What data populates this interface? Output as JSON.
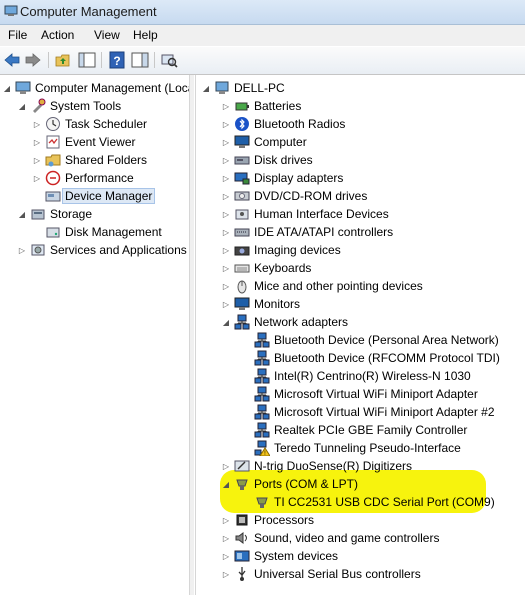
{
  "window": {
    "title": "Computer Management"
  },
  "menu": [
    "File",
    "Action",
    "View",
    "Help"
  ],
  "left_tree": [
    {
      "label": "Computer Management (Local",
      "level": 0,
      "arrow": "open",
      "icon": "computer-mgmt-icon"
    },
    {
      "label": "System Tools",
      "level": 1,
      "arrow": "open",
      "icon": "tools-icon"
    },
    {
      "label": "Task Scheduler",
      "level": 2,
      "arrow": "closed",
      "icon": "clock-icon"
    },
    {
      "label": "Event Viewer",
      "level": 2,
      "arrow": "closed",
      "icon": "event-viewer-icon"
    },
    {
      "label": "Shared Folders",
      "level": 2,
      "arrow": "closed",
      "icon": "shared-folder-icon"
    },
    {
      "label": "Performance",
      "level": 2,
      "arrow": "closed",
      "icon": "performance-icon"
    },
    {
      "label": "Device Manager",
      "level": 2,
      "arrow": "none",
      "icon": "device-manager-icon",
      "selected": true
    },
    {
      "label": "Storage",
      "level": 1,
      "arrow": "open",
      "icon": "storage-icon"
    },
    {
      "label": "Disk Management",
      "level": 2,
      "arrow": "none",
      "icon": "disk-management-icon"
    },
    {
      "label": "Services and Applications",
      "level": 1,
      "arrow": "closed",
      "icon": "services-icon"
    }
  ],
  "device_tree": [
    {
      "label": "DELL-PC",
      "level": 0,
      "arrow": "open",
      "icon": "computer-icon"
    },
    {
      "label": "Batteries",
      "level": 1,
      "arrow": "closed",
      "icon": "battery-icon"
    },
    {
      "label": "Bluetooth Radios",
      "level": 1,
      "arrow": "closed",
      "icon": "bluetooth-icon"
    },
    {
      "label": "Computer",
      "level": 1,
      "arrow": "closed",
      "icon": "monitor-icon"
    },
    {
      "label": "Disk drives",
      "level": 1,
      "arrow": "closed",
      "icon": "disk-drive-icon"
    },
    {
      "label": "Display adapters",
      "level": 1,
      "arrow": "closed",
      "icon": "display-adapter-icon"
    },
    {
      "label": "DVD/CD-ROM drives",
      "level": 1,
      "arrow": "closed",
      "icon": "dvd-icon"
    },
    {
      "label": "Human Interface Devices",
      "level": 1,
      "arrow": "closed",
      "icon": "hid-icon"
    },
    {
      "label": "IDE ATA/ATAPI controllers",
      "level": 1,
      "arrow": "closed",
      "icon": "ide-icon"
    },
    {
      "label": "Imaging devices",
      "level": 1,
      "arrow": "closed",
      "icon": "camera-icon"
    },
    {
      "label": "Keyboards",
      "level": 1,
      "arrow": "closed",
      "icon": "keyboard-icon"
    },
    {
      "label": "Mice and other pointing devices",
      "level": 1,
      "arrow": "closed",
      "icon": "mouse-icon"
    },
    {
      "label": "Monitors",
      "level": 1,
      "arrow": "closed",
      "icon": "monitor-icon"
    },
    {
      "label": "Network adapters",
      "level": 1,
      "arrow": "open",
      "icon": "network-icon"
    },
    {
      "label": "Bluetooth Device (Personal Area Network)",
      "level": 2,
      "arrow": "none",
      "icon": "network-icon"
    },
    {
      "label": "Bluetooth Device (RFCOMM Protocol TDI)",
      "level": 2,
      "arrow": "none",
      "icon": "network-icon"
    },
    {
      "label": "Intel(R) Centrino(R) Wireless-N 1030",
      "level": 2,
      "arrow": "none",
      "icon": "network-icon"
    },
    {
      "label": "Microsoft Virtual WiFi Miniport Adapter",
      "level": 2,
      "arrow": "none",
      "icon": "network-icon"
    },
    {
      "label": "Microsoft Virtual WiFi Miniport Adapter #2",
      "level": 2,
      "arrow": "none",
      "icon": "network-icon"
    },
    {
      "label": "Realtek PCIe GBE Family Controller",
      "level": 2,
      "arrow": "none",
      "icon": "network-icon"
    },
    {
      "label": "Teredo Tunneling Pseudo-Interface",
      "level": 2,
      "arrow": "none",
      "icon": "network-warning-icon"
    },
    {
      "label": "N-trig DuoSense(R) Digitizers",
      "level": 1,
      "arrow": "closed",
      "icon": "digitizer-icon"
    },
    {
      "label": "Ports (COM & LPT)",
      "level": 1,
      "arrow": "open",
      "icon": "port-icon"
    },
    {
      "label": "TI CC2531 USB CDC Serial Port (COM9)",
      "level": 2,
      "arrow": "none",
      "icon": "port-icon"
    },
    {
      "label": "Processors",
      "level": 1,
      "arrow": "closed",
      "icon": "processor-icon"
    },
    {
      "label": "Sound, video and game controllers",
      "level": 1,
      "arrow": "closed",
      "icon": "sound-icon"
    },
    {
      "label": "System devices",
      "level": 1,
      "arrow": "closed",
      "icon": "system-devices-icon"
    },
    {
      "label": "Universal Serial Bus controllers",
      "level": 1,
      "arrow": "closed",
      "icon": "usb-icon"
    }
  ],
  "toolbar": [
    "back-arrow-icon",
    "forward-arrow-icon",
    "up-folder-icon",
    "show-hide-tree-icon",
    "help-icon",
    "action-pane-icon",
    "scan-hardware-icon"
  ],
  "colors": {
    "highlight": "#f7f200",
    "selection": "#dde8f5"
  }
}
